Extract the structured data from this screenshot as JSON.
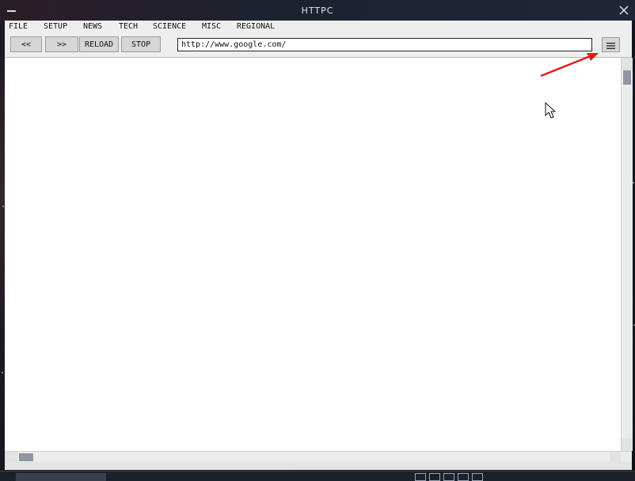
{
  "window": {
    "title": "HTTPC"
  },
  "menu": {
    "items": [
      "FILE",
      "SETUP",
      "NEWS",
      "TECH",
      "SCIENCE",
      "MISC",
      "REGIONAL"
    ]
  },
  "toolbar": {
    "back_label": "<<",
    "forward_label": ">>",
    "reload_label": "RELOAD",
    "stop_label": "STOP",
    "url_value": "http://www.google.com/",
    "menu_icon": "hamburger-icon"
  },
  "colors": {
    "annotation_arrow": "#e11b1b",
    "titlebar_text": "#e8e8e8",
    "chrome_bg": "#eeeeee"
  }
}
